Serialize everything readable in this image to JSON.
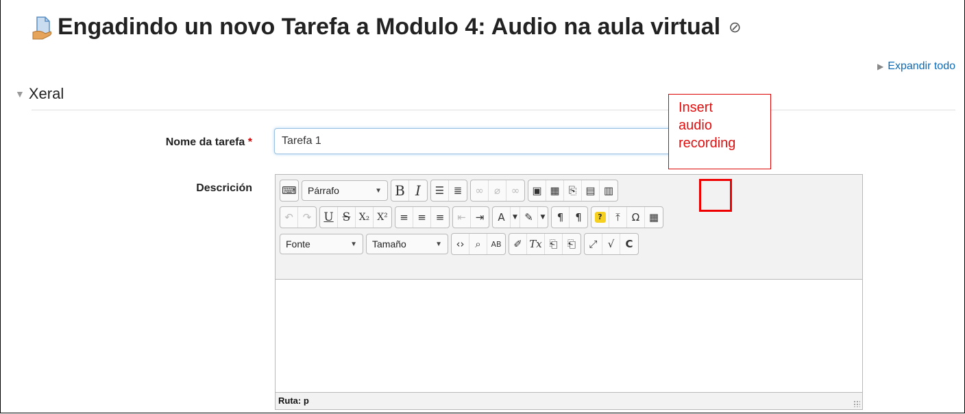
{
  "header": {
    "title": "Engadindo un novo Tarefa a Modulo 4: Audio na aula virtual",
    "help_icon": "help-icon"
  },
  "expand_all": "Expandir todo",
  "section": {
    "label": "Xeral"
  },
  "form": {
    "name_label": "Nome da tarefa",
    "required_mark": "*",
    "name_value": "Tarefa 1",
    "description_label": "Descrición"
  },
  "editor": {
    "format_select": "Párrafo",
    "font_select": "Fonte",
    "size_select": "Tamaño",
    "bold": "B",
    "italic": "I",
    "underline": "U",
    "strike": "S",
    "subscript": "X₂",
    "superscript": "X²",
    "omega": "Ω",
    "path": "Ruta: p"
  },
  "callout": {
    "line1": "Insert",
    "line2": "audio",
    "line3": "recording"
  },
  "colors": {
    "accent_link": "#0b6ab6",
    "callout_red": "#e01010"
  }
}
